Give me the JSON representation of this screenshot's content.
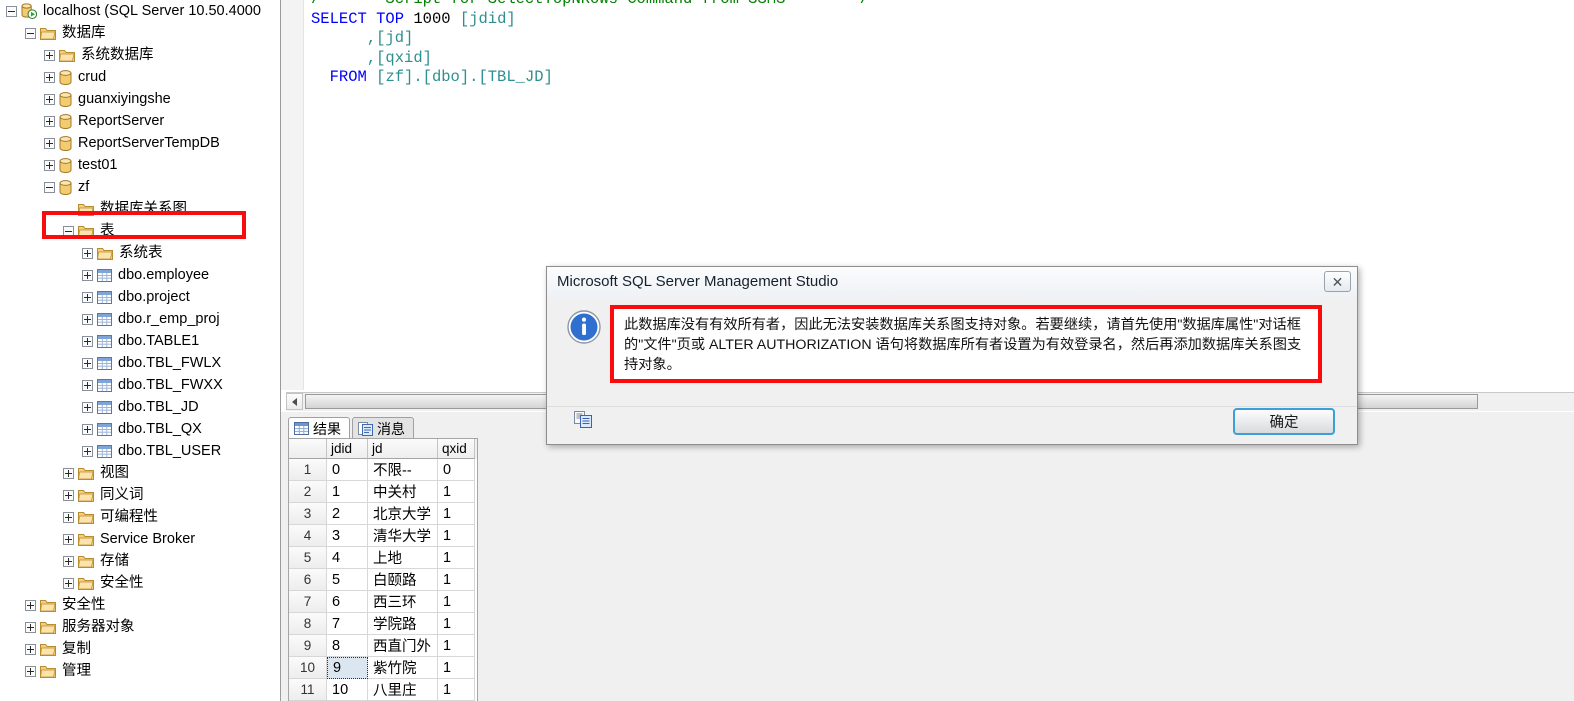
{
  "tree": {
    "items": [
      {
        "label": "localhost (SQL Server 10.50.4000",
        "indent": 0,
        "icon": "server-icon",
        "state": "minus"
      },
      {
        "label": "数据库",
        "indent": 1,
        "icon": "folder-icon",
        "state": "minus"
      },
      {
        "label": "系统数据库",
        "indent": 2,
        "icon": "folder-icon",
        "state": "plus"
      },
      {
        "label": "crud",
        "indent": 2,
        "icon": "database-icon",
        "state": "plus"
      },
      {
        "label": "guanxiyingshe",
        "indent": 2,
        "icon": "database-icon",
        "state": "plus"
      },
      {
        "label": "ReportServer",
        "indent": 2,
        "icon": "database-icon",
        "state": "plus"
      },
      {
        "label": "ReportServerTempDB",
        "indent": 2,
        "icon": "database-icon",
        "state": "plus"
      },
      {
        "label": "test01",
        "indent": 2,
        "icon": "database-icon",
        "state": "plus"
      },
      {
        "label": "zf",
        "indent": 2,
        "icon": "database-icon",
        "state": "minus"
      },
      {
        "label": "数据库关系图",
        "indent": 3,
        "icon": "folder-icon",
        "state": "none"
      },
      {
        "label": "表",
        "indent": 3,
        "icon": "folder-icon",
        "state": "minus"
      },
      {
        "label": "系统表",
        "indent": 4,
        "icon": "folder-icon",
        "state": "plus"
      },
      {
        "label": "dbo.employee",
        "indent": 4,
        "icon": "table-icon",
        "state": "plus"
      },
      {
        "label": "dbo.project",
        "indent": 4,
        "icon": "table-icon",
        "state": "plus"
      },
      {
        "label": "dbo.r_emp_proj",
        "indent": 4,
        "icon": "table-icon",
        "state": "plus"
      },
      {
        "label": "dbo.TABLE1",
        "indent": 4,
        "icon": "table-icon",
        "state": "plus"
      },
      {
        "label": "dbo.TBL_FWLX",
        "indent": 4,
        "icon": "table-icon",
        "state": "plus"
      },
      {
        "label": "dbo.TBL_FWXX",
        "indent": 4,
        "icon": "table-icon",
        "state": "plus"
      },
      {
        "label": "dbo.TBL_JD",
        "indent": 4,
        "icon": "table-icon",
        "state": "plus"
      },
      {
        "label": "dbo.TBL_QX",
        "indent": 4,
        "icon": "table-icon",
        "state": "plus"
      },
      {
        "label": "dbo.TBL_USER",
        "indent": 4,
        "icon": "table-icon",
        "state": "plus"
      },
      {
        "label": "视图",
        "indent": 3,
        "icon": "folder-icon",
        "state": "plus"
      },
      {
        "label": "同义词",
        "indent": 3,
        "icon": "folder-icon",
        "state": "plus"
      },
      {
        "label": "可编程性",
        "indent": 3,
        "icon": "folder-icon",
        "state": "plus"
      },
      {
        "label": "Service Broker",
        "indent": 3,
        "icon": "folder-icon",
        "state": "plus"
      },
      {
        "label": "存储",
        "indent": 3,
        "icon": "folder-icon",
        "state": "plus"
      },
      {
        "label": "安全性",
        "indent": 3,
        "icon": "folder-icon",
        "state": "plus"
      },
      {
        "label": "安全性",
        "indent": 1,
        "icon": "folder-icon",
        "state": "plus"
      },
      {
        "label": "服务器对象",
        "indent": 1,
        "icon": "folder-icon",
        "state": "plus"
      },
      {
        "label": "复制",
        "indent": 1,
        "icon": "folder-icon",
        "state": "plus"
      },
      {
        "label": "管理",
        "indent": 1,
        "icon": "folder-icon",
        "state": "plus"
      }
    ]
  },
  "editor": {
    "comment_line": "/****** Script for SelectTopNRows Command from SSMS  ******/",
    "line1_select": "SELECT",
    "line1_top": "TOP",
    "line1_count": "1000",
    "line1_col": "[jdid]",
    "line2": ",[jd]",
    "line3": ",[qxid]",
    "line4_from": "FROM",
    "line4_target": "[zf].[dbo].[TBL_JD]"
  },
  "results": {
    "tabs": [
      {
        "label": "结果",
        "icon": "grid-icon",
        "active": true
      },
      {
        "label": "消息",
        "icon": "message-icon",
        "active": false
      }
    ],
    "columns": [
      "jdid",
      "jd",
      "qxid"
    ],
    "rows": [
      {
        "n": "1",
        "jdid": "0",
        "jd": "不限--",
        "qxid": "0"
      },
      {
        "n": "2",
        "jdid": "1",
        "jd": "中关村",
        "qxid": "1"
      },
      {
        "n": "3",
        "jdid": "2",
        "jd": "北京大学",
        "qxid": "1"
      },
      {
        "n": "4",
        "jdid": "3",
        "jd": "清华大学",
        "qxid": "1"
      },
      {
        "n": "5",
        "jdid": "4",
        "jd": "上地",
        "qxid": "1"
      },
      {
        "n": "6",
        "jdid": "5",
        "jd": "白颐路",
        "qxid": "1"
      },
      {
        "n": "7",
        "jdid": "6",
        "jd": "西三环",
        "qxid": "1"
      },
      {
        "n": "8",
        "jdid": "7",
        "jd": "学院路",
        "qxid": "1"
      },
      {
        "n": "9",
        "jdid": "8",
        "jd": "西直门外",
        "qxid": "1"
      },
      {
        "n": "10",
        "jdid": "9",
        "jd": "紫竹院",
        "qxid": "1"
      },
      {
        "n": "11",
        "jdid": "10",
        "jd": "八里庄",
        "qxid": "1"
      }
    ],
    "selected_cell": {
      "row": 9,
      "column": "jdid"
    }
  },
  "dialog": {
    "title": "Microsoft SQL Server Management Studio",
    "close_label": "✕",
    "icon": "info-icon",
    "message": "此数据库没有有效所有者，因此无法安装数据库关系图支持对象。若要继续，请首先使用\"数据库属性\"对话框的\"文件\"页或 ALTER AUTHORIZATION 语句将数据库所有者设置为有效登录名，然后再添加数据库关系图支持对象。",
    "copy_icon": "copy-to-clipboard-icon",
    "ok_label": "确定"
  },
  "colors": {
    "highlight_red": "#fb0b0b",
    "focus_blue": "#3c9fd8",
    "keyword_blue": "#0000ff",
    "identifier_teal": "#2f8f8f",
    "comment_green": "#008000"
  }
}
